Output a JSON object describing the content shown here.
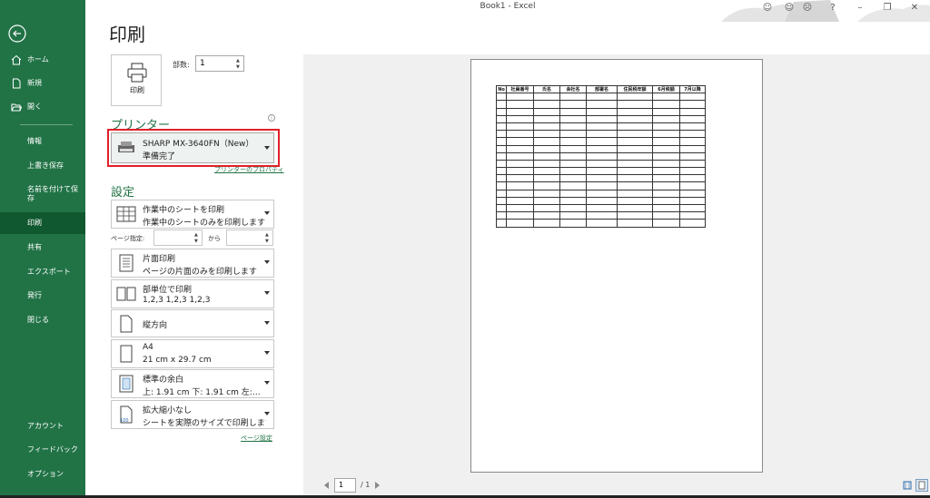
{
  "window": {
    "title": "Book1  -  Excel"
  },
  "sidebar": {
    "items": [
      {
        "label": "ホーム"
      },
      {
        "label": "新規"
      },
      {
        "label": "開く"
      },
      {
        "label": "情報"
      },
      {
        "label": "上書き保存"
      },
      {
        "label": "名前を付けて保存"
      },
      {
        "label": "印刷"
      },
      {
        "label": "共有"
      },
      {
        "label": "エクスポート"
      },
      {
        "label": "発行"
      },
      {
        "label": "閉じる"
      },
      {
        "label": "アカウント"
      },
      {
        "label": "フィードバック"
      },
      {
        "label": "オプション"
      }
    ]
  },
  "print": {
    "title": "印刷",
    "print_button": "印刷",
    "copies_label": "部数:",
    "copies_value": "1",
    "printer_section": "プリンター",
    "printer_name": "SHARP MX-3640FN（New）",
    "printer_status": "準備完了",
    "printer_properties": "プリンターのプロパティ",
    "settings_section": "設定",
    "settings": {
      "scope": {
        "l1": "作業中のシートを印刷",
        "l2": "作業中のシートのみを印刷します"
      },
      "pages_label": "ページ指定:",
      "pages_to": "から",
      "sides": {
        "l1": "片面印刷",
        "l2": "ページの片面のみを印刷します"
      },
      "collate": {
        "l1": "部単位で印刷",
        "l2": "1,2,3    1,2,3    1,2,3"
      },
      "orientation": {
        "l1": "縦方向"
      },
      "paper": {
        "l1": "A4",
        "l2": "21 cm x 29.7 cm"
      },
      "margins": {
        "l1": "標準の余白",
        "l2": "上: 1.91 cm 下: 1.91 cm 左:…"
      },
      "scaling": {
        "l1": "拡大縮小なし",
        "l2": "シートを実際のサイズで印刷します"
      }
    },
    "page_setup": "ページ設定"
  },
  "preview": {
    "headers": [
      "No",
      "社員番号",
      "氏名",
      "会社名",
      "部署名",
      "住民税年額",
      "6月税額",
      "7月以降"
    ],
    "empty_rows": 18,
    "page_current": "1",
    "page_total": "/ 1"
  }
}
